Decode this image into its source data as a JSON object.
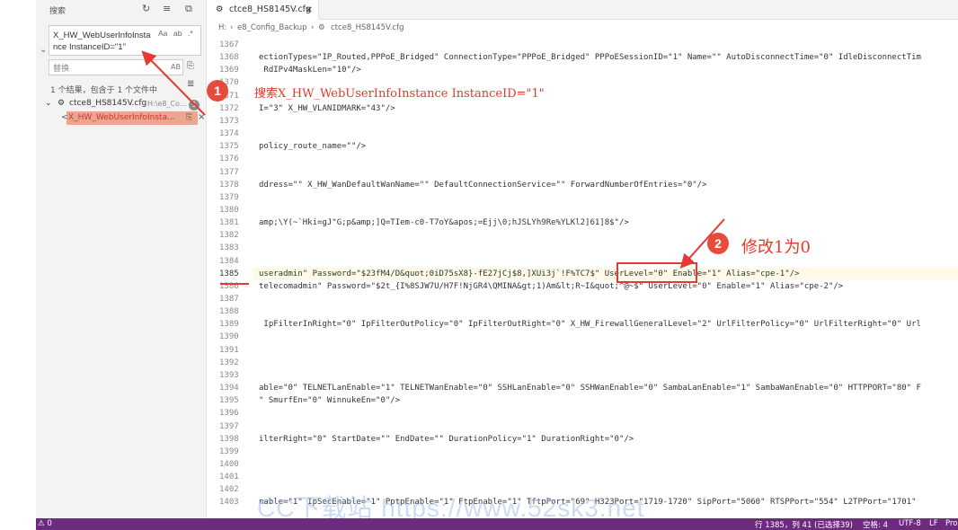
{
  "sidebar": {
    "title": "搜索",
    "search_query": "X_HW_WebUserInfoInstance InstanceID=\"1\"",
    "options": [
      "Aa",
      "ab",
      ".*"
    ],
    "replace_placeholder": "替换",
    "replace_option": "AB",
    "result_summary": "1 个结果，包含于 1 个文件中",
    "file_name": "ctce8_HS8145V.cfg",
    "file_path": "H:\\e8_Co...",
    "file_count": "1",
    "match_prefix": "<",
    "match_text": "X_HW_WebUserInfoInsta..."
  },
  "tab": {
    "label": "ctce8_HS8145V.cfg",
    "close": "×"
  },
  "breadcrumb": {
    "drive": "H:",
    "folder": "e8_Config_Backup",
    "file": "ctce8_HS8145V.cfg"
  },
  "lines": [
    {
      "n": "1367",
      "t": ""
    },
    {
      "n": "1368",
      "t": "ectionTypes=\"IP_Routed,PPPoE_Bridged\" ConnectionType=\"PPPoE_Bridged\" PPPoESessionID=\"1\" Name=\"\" AutoDisconnectTime=\"0\" IdleDisconnectTim"
    },
    {
      "n": "1369",
      "t": " RdIPv4MaskLen=\"10\"/>"
    },
    {
      "n": "1370",
      "t": ""
    },
    {
      "n": "1371",
      "t": ""
    },
    {
      "n": "1372",
      "t": "I=\"3\" X_HW_VLANIDMARK=\"43\"/>"
    },
    {
      "n": "1373",
      "t": ""
    },
    {
      "n": "1374",
      "t": ""
    },
    {
      "n": "1375",
      "t": "policy_route_name=\"\"/>"
    },
    {
      "n": "1376",
      "t": ""
    },
    {
      "n": "1377",
      "t": ""
    },
    {
      "n": "1378",
      "t": "ddress=\"\" X_HW_WanDefaultWanName=\"\" DefaultConnectionService=\"\" ForwardNumberOfEntries=\"0\"/>"
    },
    {
      "n": "1379",
      "t": ""
    },
    {
      "n": "1380",
      "t": ""
    },
    {
      "n": "1381",
      "t": "amp;\\Y(~`Hki=gJ\"G;p&amp;]Q=TIem-c0-T7oY&apos;=Ejj\\0;hJSLYh9Re%YLKl2]61]8$\"/>"
    },
    {
      "n": "1382",
      "t": ""
    },
    {
      "n": "1383",
      "t": ""
    },
    {
      "n": "1384",
      "t": ""
    },
    {
      "n": "1385",
      "t": "useradmin\" Password=\"$23fM4/D&quot;0iD75sX8}-fE27jCj$8,]XUi3j`!F%TC7$\" UserLevel=\"0\" Enable=\"1\" Alias=\"cpe-1\"/>"
    },
    {
      "n": "1386",
      "t": "telecomadmin\" Password=\"$2t_{I%8SJW7U/H7F!NjGR4\\QMINA&gt;1)Am&lt;R~I&quot;^@~$\" UserLevel=\"0\" Enable=\"1\" Alias=\"cpe-2\"/>"
    },
    {
      "n": "1387",
      "t": ""
    },
    {
      "n": "1388",
      "t": ""
    },
    {
      "n": "1389",
      "t": " IpFilterInRight=\"0\" IpFilterOutPolicy=\"0\" IpFilterOutRight=\"0\" X_HW_FirewallGeneralLevel=\"2\" UrlFilterPolicy=\"0\" UrlFilterRight=\"0\" Url"
    },
    {
      "n": "1390",
      "t": ""
    },
    {
      "n": "1391",
      "t": ""
    },
    {
      "n": "1392",
      "t": ""
    },
    {
      "n": "1393",
      "t": ""
    },
    {
      "n": "1394",
      "t": "able=\"0\" TELNETLanEnable=\"1\" TELNETWanEnable=\"0\" SSHLanEnable=\"0\" SSHWanEnable=\"0\" SambaLanEnable=\"1\" SambaWanEnable=\"0\" HTTPPORT=\"80\" F"
    },
    {
      "n": "1395",
      "t": "\" SmurfEn=\"0\" WinnukeEn=\"0\"/>"
    },
    {
      "n": "1396",
      "t": ""
    },
    {
      "n": "1397",
      "t": ""
    },
    {
      "n": "1398",
      "t": "ilterRight=\"0\" StartDate=\"\" EndDate=\"\" DurationPolicy=\"1\" DurationRight=\"0\"/>"
    },
    {
      "n": "1399",
      "t": ""
    },
    {
      "n": "1400",
      "t": ""
    },
    {
      "n": "1401",
      "t": ""
    },
    {
      "n": "1402",
      "t": ""
    },
    {
      "n": "1403",
      "t": "nable=\"1\" IpSecEnable=\"1\" PptpEnable=\"1\" FtpEnable=\"1\" TftpPort=\"69\" H323Port=\"1719-1720\" SipPort=\"5060\" RTSPPort=\"554\" L2TPPort=\"1701\""
    }
  ],
  "annotations": {
    "step1_number": "1",
    "step1_text": "搜索X_HW_WebUserInfoInstance InstanceID=\"1\"",
    "step2_number": "2",
    "step2_text": "修改1为0"
  },
  "watermark": "CC下载站 https://www.52sk3.net",
  "statusbar": {
    "left": "⚠ 0",
    "position": "行 1385，列 41 (已选择39)",
    "indent": "空格: 4",
    "encoding": "UTF-8",
    "eol": "LF",
    "lang": "Pro"
  },
  "colors": {
    "accent_red": "#e53935",
    "statusbar": "#6d2a80",
    "match_highlight": "#e8a78e"
  }
}
